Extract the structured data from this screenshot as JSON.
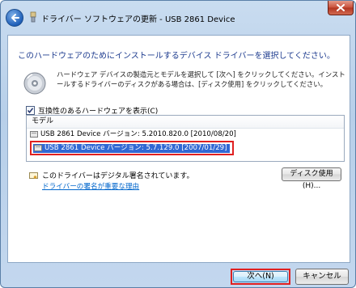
{
  "window": {
    "title": "ドライバー ソフトウェアの更新 - USB 2861 Device"
  },
  "header": {
    "text": "このハードウェアのためにインストールするデバイス ドライバーを選択してください。"
  },
  "instructions": "ハードウェア デバイスの製造元とモデルを選択して [次へ] をクリックしてください。インストールするドライバーのディスクがある場合は、[ディスク使用] をクリックしてください。",
  "compatible_checkbox": {
    "label": "互換性のあるハードウェアを表示(C)",
    "checked": true
  },
  "model_list": {
    "header": "モデル",
    "items": [
      {
        "label": "USB 2861 Device バージョン: 5.2010.820.0 [2010/08/20]",
        "selected": false
      },
      {
        "label": "USB 2861 Device バージョン: 5.7.129.0 [2007/01/29]",
        "selected": true
      }
    ]
  },
  "signature": {
    "text": "このドライバーはデジタル署名されています。",
    "link": "ドライバーの署名が重要な理由"
  },
  "buttons": {
    "have_disk": "ディスク使用(H)...",
    "next": "次へ(N)",
    "cancel": "キャンセル"
  },
  "icons": {
    "back": "back-arrow-icon",
    "title": "device-icon",
    "close": "close-icon",
    "disk": "cd-disk-icon",
    "signature": "certificate-icon",
    "list_item": "driver-icon"
  },
  "colors": {
    "header_text": "#1e3c8f",
    "selection": "#3168d4",
    "highlight_border": "#e02020",
    "link": "#0066cc"
  }
}
